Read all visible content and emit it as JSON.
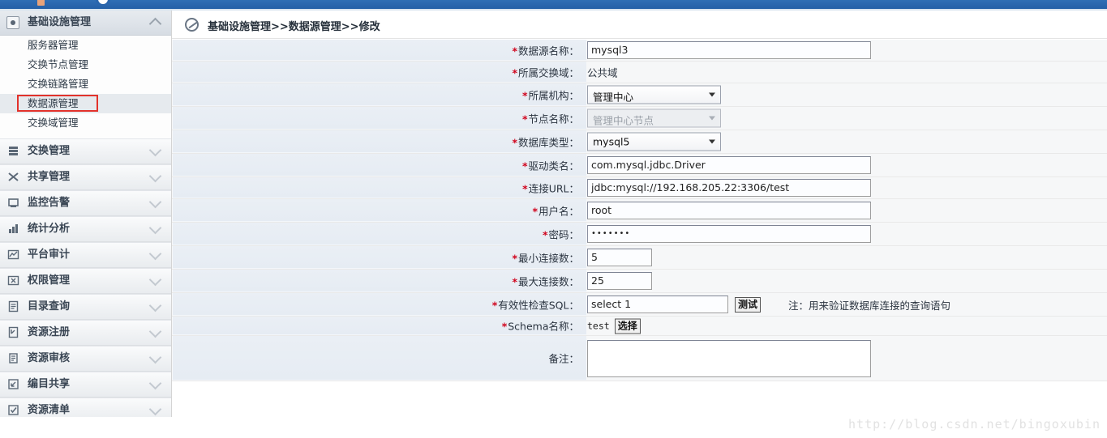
{
  "topbar": {
    "icon1": "orange-square-icon",
    "icon2": "circle-icon"
  },
  "sidebar": {
    "header": {
      "label": "基础设施管理",
      "icon": "infrastructure-icon",
      "collapse_icon": "chevron-up-icon"
    },
    "sub_items": [
      {
        "label": "服务器管理",
        "active": false
      },
      {
        "label": "交换节点管理",
        "active": false
      },
      {
        "label": "交换链路管理",
        "active": false
      },
      {
        "label": "数据源管理",
        "active": true
      },
      {
        "label": "交换域管理",
        "active": false
      }
    ],
    "menus": [
      {
        "label": "交换管理",
        "icon": "exchange-icon"
      },
      {
        "label": "共享管理",
        "icon": "share-icon"
      },
      {
        "label": "监控告警",
        "icon": "monitor-icon"
      },
      {
        "label": "统计分析",
        "icon": "statistics-icon"
      },
      {
        "label": "平台审计",
        "icon": "audit-icon"
      },
      {
        "label": "权限管理",
        "icon": "permission-icon"
      },
      {
        "label": "目录查询",
        "icon": "catalog-icon"
      },
      {
        "label": "资源注册",
        "icon": "register-icon"
      },
      {
        "label": "资源审核",
        "icon": "review-icon"
      },
      {
        "label": "编目共享",
        "icon": "catalog-share-icon"
      },
      {
        "label": "资源清单",
        "icon": "checklist-icon"
      }
    ]
  },
  "breadcrumb": {
    "icon": "compass-icon",
    "text": "基础设施管理>>数据源管理>>修改"
  },
  "form": {
    "required_mark": "*",
    "rows": [
      {
        "label": "数据源名称：",
        "required": true,
        "type": "text",
        "value": "mysql3"
      },
      {
        "label": "所属交换域：",
        "required": true,
        "type": "static",
        "value": "公共域"
      },
      {
        "label": "所属机构：",
        "required": true,
        "type": "select",
        "value": "管理中心",
        "disabled": false
      },
      {
        "label": "节点名称：",
        "required": true,
        "type": "select",
        "value": "管理中心节点",
        "disabled": true
      },
      {
        "label": "数据库类型：",
        "required": true,
        "type": "select",
        "value": "mysql5",
        "disabled": false
      },
      {
        "label": "驱动类名：",
        "required": true,
        "type": "text",
        "value": "com.mysql.jdbc.Driver"
      },
      {
        "label": "连接URL：",
        "required": true,
        "type": "text",
        "value": "jdbc:mysql://192.168.205.22:3306/test"
      },
      {
        "label": "用户名：",
        "required": true,
        "type": "text",
        "value": "root"
      },
      {
        "label": "密码：",
        "required": true,
        "type": "password",
        "value": "•••••••"
      },
      {
        "label": "最小连接数：",
        "required": true,
        "type": "number",
        "value": "5"
      },
      {
        "label": "最大连接数：",
        "required": true,
        "type": "number",
        "value": "25"
      },
      {
        "label": "有效性检查SQL：",
        "required": true,
        "type": "sql",
        "value": "select 1",
        "button": "测试",
        "note": "注：用来验证数据库连接的查询语句"
      },
      {
        "label": "Schema名称：",
        "required": true,
        "type": "schema",
        "value": "test",
        "button": "选择"
      },
      {
        "label": "备注：",
        "required": false,
        "type": "textarea",
        "value": ""
      }
    ]
  },
  "watermark": "http://blog.csdn.net/bingoxubin"
}
